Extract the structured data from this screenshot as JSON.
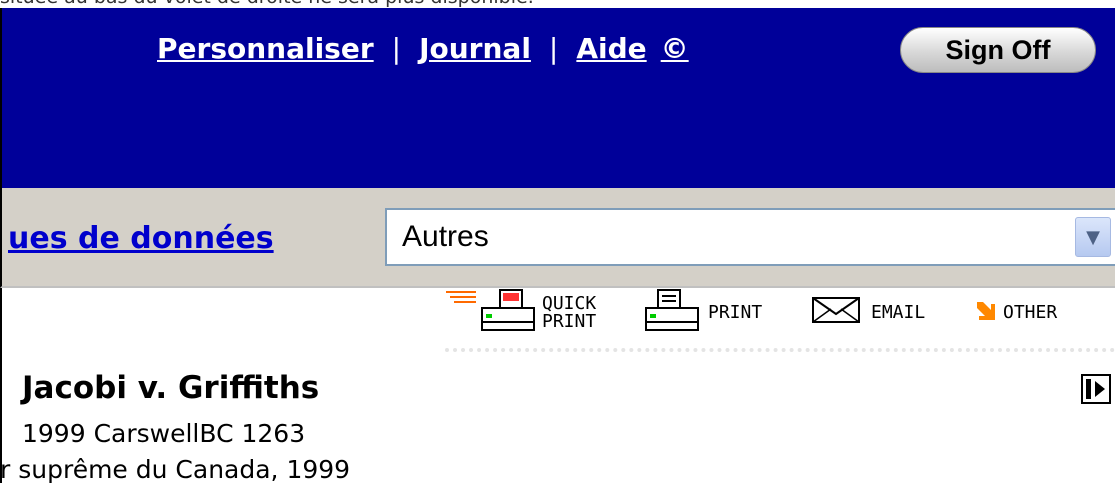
{
  "notice_text": "située au bas du volet de droite ne sera plus disponible.",
  "header": {
    "nav": {
      "personnaliser": "Personnaliser",
      "sep1": "|",
      "journal": "Journal",
      "sep2": "|",
      "aide": "Aide",
      "copyright": "©"
    },
    "sign_off": "Sign Off",
    "bg_color": "#000099"
  },
  "db_bar": {
    "link": "ues de données",
    "select_value": "Autres"
  },
  "toolbar": {
    "quick_print_line1": "QUICK",
    "quick_print_line2": "PRINT",
    "print": "PRINT",
    "email": "EMAIL",
    "other": "OTHER"
  },
  "document": {
    "title": "Jacobi v. Griffiths",
    "citation": "1999 CarswellBC 1263",
    "court": "r suprême du Canada, 1999"
  }
}
